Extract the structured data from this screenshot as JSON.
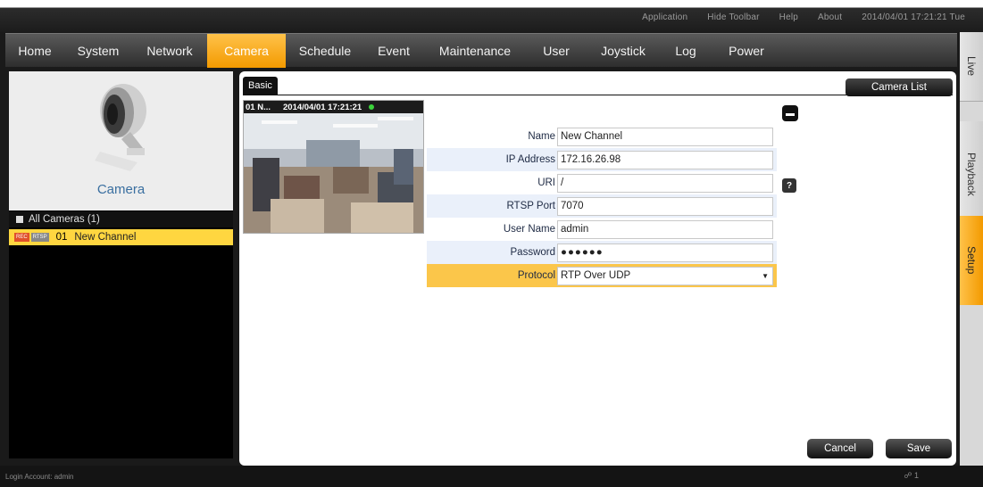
{
  "toolbar": {
    "links": [
      "Application",
      "Hide Toolbar",
      "Help",
      "About"
    ],
    "datetime": "2014/04/01 17:21:21 Tue"
  },
  "nav": {
    "items": [
      "Home",
      "System",
      "Network",
      "Camera",
      "Schedule",
      "Event",
      "Maintenance",
      "User",
      "Joystick",
      "Log",
      "Power"
    ],
    "active": "Camera"
  },
  "side_tabs": {
    "live": "Live",
    "playback": "Playback",
    "setup": "Setup"
  },
  "left_panel": {
    "caption": "Camera",
    "tree_root": "All Cameras (1)",
    "tree_item": {
      "rec_badge": "REC",
      "rtsp_badge": "RTSP",
      "number": "01",
      "name": "New Channel"
    }
  },
  "main": {
    "tab_label": "Basic",
    "camera_list_button": "Camera List",
    "preview": {
      "label": "01 N...",
      "timestamp": "2014/04/01 17:21:21"
    },
    "form": {
      "name_label": "Name",
      "name_value": "New Channel",
      "ip_label": "IP Address",
      "ip_value": "172.16.26.98",
      "uri_label": "URI",
      "uri_value": "/",
      "rtsp_port_label": "RTSP Port",
      "rtsp_port_value": "7070",
      "username_label": "User Name",
      "username_value": "admin",
      "password_label": "Password",
      "password_value": "●●●●●●",
      "protocol_label": "Protocol",
      "protocol_value": "RTP Over UDP"
    },
    "help_glyph": "?",
    "cancel_button": "Cancel",
    "save_button": "Save"
  },
  "status": {
    "login": "Login Account: admin",
    "net": "1"
  },
  "colors": {
    "accent": "#f39a00",
    "selected_row": "#fbc64a",
    "tree_selected": "#ffd640"
  }
}
